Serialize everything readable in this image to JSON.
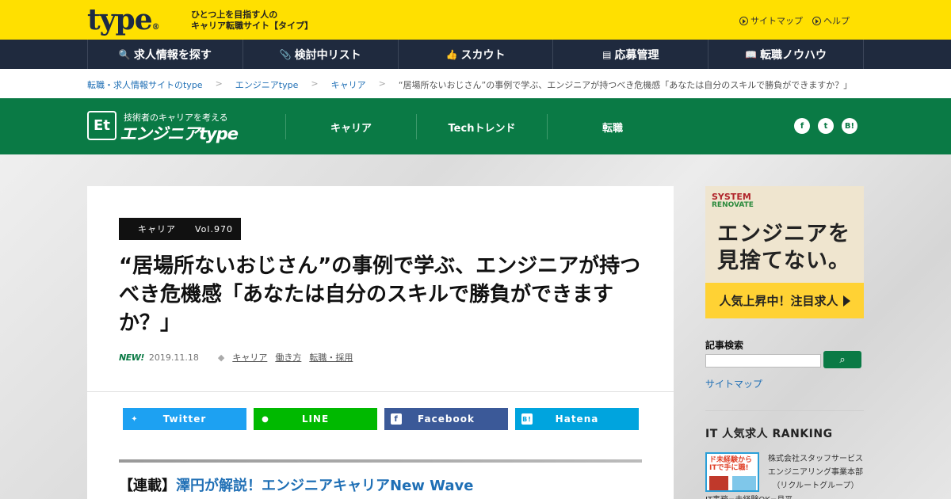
{
  "header": {
    "logo": "type",
    "logo_mark": "®",
    "tagline_line1": "ひとつ上を目指す人の",
    "tagline_line2": "キャリア転職サイト【タイプ】",
    "links": [
      "サイトマップ",
      "ヘルプ"
    ]
  },
  "nav": {
    "items": [
      {
        "label": "求人情報を探す",
        "icon": "search-icon",
        "glyph": "🔍"
      },
      {
        "label": "検討中リスト",
        "icon": "paperclip-icon",
        "glyph": "📎"
      },
      {
        "label": "スカウト",
        "icon": "thumbs-up-icon",
        "glyph": "👍"
      },
      {
        "label": "応募管理",
        "icon": "list-icon",
        "glyph": "▤"
      },
      {
        "label": "転職ノウハウ",
        "icon": "book-icon",
        "glyph": "📖"
      }
    ]
  },
  "breadcrumb": {
    "items": [
      "転職・求人情報サイトのtype",
      "エンジニアtype",
      "キャリア",
      "“居場所ないおじさん”の事例で学ぶ、エンジニアが持つべき危機感「あなたは自分のスキルで勝負ができますか？」"
    ],
    "separator": ">"
  },
  "site": {
    "mark": "Et",
    "subtitle": "技術者のキャリアを考える",
    "name": "エンジニアtype",
    "nav": [
      "キャリア",
      "Techトレンド",
      "転職"
    ],
    "social": [
      {
        "icon": "facebook-icon",
        "glyph": "f"
      },
      {
        "icon": "twitter-icon",
        "glyph": "t"
      },
      {
        "icon": "hatena-icon",
        "glyph": "B!"
      }
    ]
  },
  "article": {
    "category": "キャリア",
    "volume": "Vol.970",
    "title": "“居場所ないおじさん”の事例で学ぶ、エンジニアが持つべき危機感「あなたは自分のスキルで勝負ができますか？」",
    "new_label": "NEW!",
    "date": "2019.11.18",
    "tags": [
      "キャリア",
      "働き方",
      "転職・採用"
    ],
    "share": [
      {
        "label": "Twitter",
        "icon": "twitter-icon",
        "glyph": "✦"
      },
      {
        "label": "LINE",
        "icon": "line-icon",
        "glyph": "●"
      },
      {
        "label": "Facebook",
        "icon": "facebook-icon",
        "glyph": "f"
      },
      {
        "label": "Hatena",
        "icon": "hatena-icon",
        "glyph": "B!"
      }
    ],
    "series_prefix": "【連載】",
    "series_link": "澤円が解説！エンジニアキャリアNew Wave"
  },
  "sidebar": {
    "ad": {
      "brand_line1": "SYSTEM",
      "brand_line2": "RENOVATE",
      "headline": "エンジニアを見捨てない。",
      "cta": "人気上昇中！注目求人"
    },
    "search_label": "記事検索",
    "search_placeholder": "",
    "search_button_glyph": "⌕",
    "sitemap": "サイトマップ",
    "ranking_title": "IT 人気求人 RANKING",
    "ranking_item": {
      "thumb_text": "ド未経験からITで手に職!",
      "company_line1": "株式会社スタッフサービス",
      "company_line2": "エンジニアリング事業本部",
      "company_line3": "（リクルートグループ）",
      "desc": "IT事務=未経験OK=月平"
    }
  }
}
